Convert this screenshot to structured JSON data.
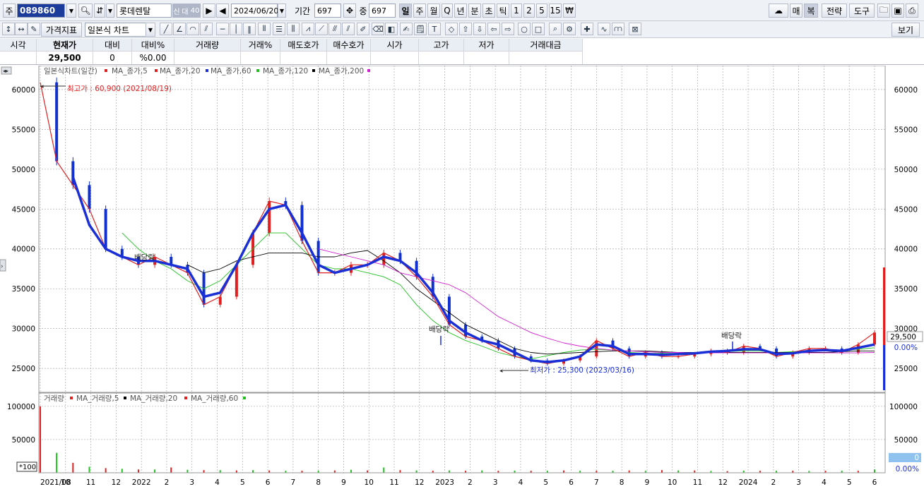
{
  "toolbar": {
    "market_label": "주",
    "stock_code": "089860",
    "stock_name": "롯데렌탈",
    "badge_credit": "신",
    "badge_margin": "대",
    "badge_rate": "40",
    "date": "2024/06/20",
    "period_label": "기간",
    "period_value": "697",
    "count_label": "중",
    "count_value": "697",
    "periods": [
      "일",
      "주",
      "월",
      "Q",
      "년",
      "분",
      "초",
      "틱",
      "1",
      "2",
      "5",
      "15",
      "₩"
    ],
    "right_buttons": [
      "매",
      "복",
      "전략",
      "도구"
    ],
    "indicator_button": "가격지표",
    "chart_type": "일본식 차트",
    "view_button": "보기"
  },
  "quote": {
    "headers": [
      "시각",
      "현재가",
      "대비",
      "대비%",
      "거래량",
      "거래%",
      "매도호가",
      "매수호가",
      "시가",
      "고가",
      "저가",
      "거래대금"
    ],
    "values": [
      "",
      "29,500",
      "0",
      "%0.00",
      "",
      "",
      "",
      "",
      "",
      "",
      "",
      ""
    ]
  },
  "colors": {
    "candle_up": "#e02020",
    "candle_down": "#1030d0",
    "ma5": "#e02020",
    "ma20": "#1a2fd6",
    "ma60": "#20c020",
    "ma120": "#000000",
    "ma200": "#d020d0"
  },
  "price_panel": {
    "legend_title": "일본식차트(일간)",
    "legend_items": [
      "MA_종가,5",
      "MA_종가,20",
      "MA_종가,60",
      "MA_종가,120",
      "MA_종가,200"
    ],
    "high_annotation": "최고가 : 60,900 (2021/08/19)",
    "low_annotation": "최저가 : 25,300 (2023/03/16)",
    "dividend_label": "배당락",
    "current_price": "29,500",
    "current_pct": "0.00%"
  },
  "volume_panel": {
    "legend_title": "거래량",
    "legend_items": [
      "MA_거래량,5",
      "MA_거래량,20",
      "MA_거래량,60"
    ],
    "multiplier": "*100",
    "current_volume": "0",
    "current_pct": "0.00%"
  },
  "chart_data": {
    "type": "line",
    "x_labels": [
      "2021/08",
      "10",
      "11",
      "12",
      "2022",
      "2",
      "3",
      "4",
      "5",
      "6",
      "7",
      "8",
      "9",
      "10",
      "11",
      "12",
      "2023",
      "2",
      "3",
      "4",
      "5",
      "6",
      "7",
      "8",
      "9",
      "10",
      "11",
      "12",
      "2024",
      "2",
      "3",
      "4",
      "5",
      "6"
    ],
    "y_ticks": [
      25000,
      30000,
      35000,
      40000,
      45000,
      50000,
      55000,
      60000
    ],
    "ylim": [
      22000,
      63000
    ],
    "volume_ticks": [
      50000,
      100000
    ],
    "volume_ylim": [
      0,
      120000
    ],
    "series": [
      {
        "name": "MA_종가,5",
        "values": [
          60900,
          51000,
          48000,
          45000,
          40000,
          39000,
          38000,
          39000,
          38000,
          37000,
          33000,
          34000,
          38000,
          42000,
          46000,
          45500,
          41000,
          37000,
          37000,
          38000,
          38000,
          39500,
          38500,
          36500,
          34000,
          30500,
          29000,
          28500,
          27500,
          26500,
          26000,
          25600,
          26000,
          26500,
          28500,
          27500,
          26500,
          27000,
          26500,
          26500,
          26800,
          27200,
          27000,
          27800,
          27500,
          26500,
          27000,
          27500,
          27500,
          27000,
          28000,
          29500
        ]
      },
      {
        "name": "MA_종가,20",
        "values": [
          null,
          null,
          49000,
          43000,
          40000,
          39000,
          38500,
          38500,
          38000,
          37500,
          34000,
          34500,
          38000,
          42000,
          45000,
          45500,
          42000,
          38000,
          37000,
          37500,
          38000,
          39000,
          38500,
          37000,
          34500,
          31000,
          29500,
          28500,
          28000,
          27000,
          26000,
          25800,
          26000,
          26500,
          28000,
          27800,
          26800,
          26800,
          26700,
          26800,
          26900,
          27100,
          27200,
          27400,
          27400,
          26800,
          26900,
          27200,
          27300,
          27200,
          27600,
          28000
        ]
      },
      {
        "name": "MA_종가,60",
        "values": [
          null,
          null,
          null,
          null,
          null,
          42000,
          40000,
          38500,
          37500,
          36000,
          35000,
          36000,
          38000,
          40000,
          42000,
          42000,
          40000,
          38000,
          37500,
          37500,
          37000,
          36500,
          35500,
          33000,
          31000,
          29500,
          28500,
          27800,
          27000,
          26500,
          26200,
          26600,
          27000,
          27300,
          27400,
          27300,
          27000,
          26900,
          26900,
          26900,
          27000,
          27100,
          27100,
          27200,
          27200,
          27000,
          27100,
          27200,
          27300,
          27300,
          27400,
          27600
        ]
      },
      {
        "name": "MA_종가,120",
        "values": [
          null,
          null,
          null,
          null,
          null,
          null,
          null,
          null,
          null,
          38000,
          37000,
          37500,
          38500,
          39000,
          39500,
          39500,
          39500,
          39000,
          39000,
          39500,
          39800,
          38500,
          37000,
          35000,
          33500,
          32000,
          30500,
          29500,
          28500,
          27500,
          27000,
          26800,
          26900,
          27000,
          27100,
          27200,
          27200,
          27200,
          27100,
          27000,
          27000,
          27000,
          27000,
          27000,
          27000,
          27000,
          27000,
          27000,
          27000,
          27100,
          27200,
          27200
        ]
      },
      {
        "name": "MA_종가,200",
        "values": [
          null,
          null,
          null,
          null,
          null,
          null,
          null,
          null,
          null,
          null,
          null,
          null,
          null,
          null,
          null,
          null,
          null,
          40000,
          39500,
          39000,
          38500,
          38000,
          37000,
          36500,
          36000,
          35500,
          34500,
          33000,
          31500,
          30500,
          29500,
          28800,
          28200,
          27800,
          27500,
          27300,
          27200,
          27100,
          27000,
          27000,
          26950,
          26950,
          26950,
          26950,
          26950,
          26950,
          26950,
          26950,
          26950,
          26950,
          26950,
          27000
        ]
      }
    ],
    "volume_values": [
      100000,
      30000,
      15000,
      9000,
      7000,
      6000,
      5000,
      5000,
      8000,
      4500,
      4000,
      4000,
      3500,
      4000,
      3500,
      3000,
      3000,
      3000,
      3500,
      4500,
      3500,
      8000,
      4000,
      3500,
      3000,
      3500,
      3000,
      3500,
      3000,
      3200,
      3000,
      3000,
      3500,
      3000,
      3000,
      3000,
      3500,
      3000,
      4000,
      3500,
      3500,
      2800,
      2500,
      3200,
      3000,
      3000,
      3000,
      2800,
      3000,
      3000,
      3000,
      5000
    ]
  }
}
